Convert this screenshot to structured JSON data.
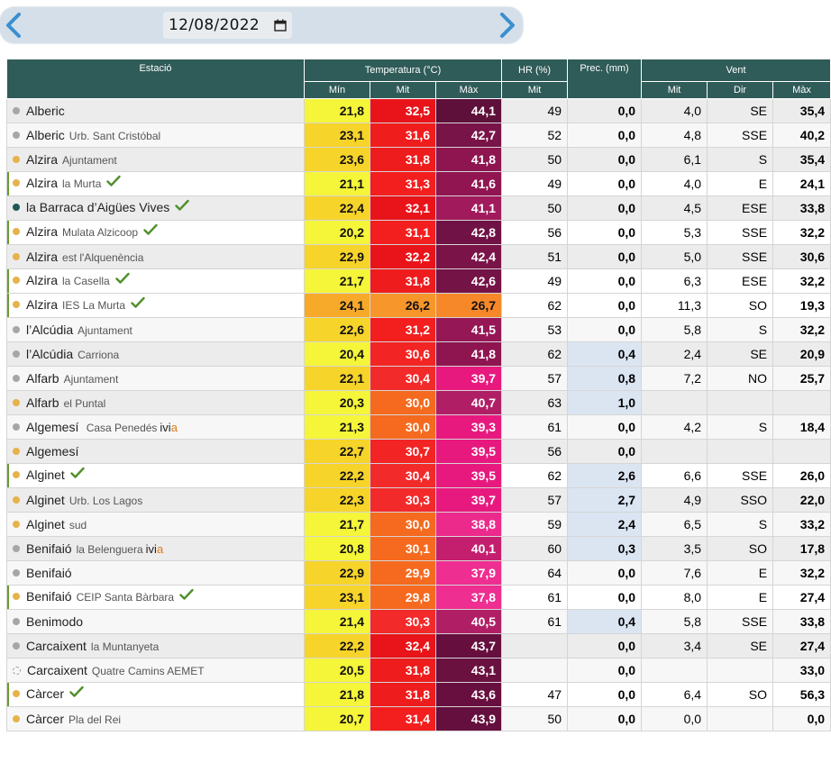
{
  "date": "12/08/2022",
  "colors": {
    "header_bg": "#2f5b58",
    "dot_gray": "#a6a6a6",
    "dot_orange": "#e6b24a",
    "dot_teal": "#1d5a56",
    "check": "#4f8f2a"
  },
  "icons": {
    "prev": "chevron-left-icon",
    "next": "chevron-right-icon",
    "calendar": "calendar-icon",
    "verified": "check-icon"
  },
  "headers": {
    "station": "Estació",
    "temperature": "Temperatura (°C)",
    "humidity": "HR (%)",
    "precipitation": "Prec. (mm)",
    "wind": "Vent",
    "min": "Mín",
    "mid": "Mit",
    "max": "Màx",
    "hr_mid": "Mit",
    "wind_mid": "Mit",
    "wind_dir": "Dir",
    "wind_max": "Màx"
  },
  "rows": [
    {
      "name": "Alberic",
      "sub": "",
      "dot": "gray",
      "check": false,
      "ivia": false,
      "mark": false,
      "tmin": "21,8",
      "tmid": "32,5",
      "tmax": "44,1",
      "hr": "49",
      "prec": "0,0",
      "wmid": "4,0",
      "wdir": "SE",
      "wmax": "35,4",
      "c": [
        "#f5f53a",
        "#e8141a",
        "#5e0f3a"
      ],
      "pb": false
    },
    {
      "name": "Alberic",
      "sub": "Urb. Sant Cristóbal",
      "dot": "gray",
      "check": false,
      "ivia": false,
      "mark": false,
      "tmin": "23,1",
      "tmid": "31,6",
      "tmax": "42,7",
      "hr": "52",
      "prec": "0,0",
      "wmid": "4,8",
      "wdir": "SSE",
      "wmax": "40,2",
      "c": [
        "#f7d42a",
        "#f01d1d",
        "#781448"
      ],
      "pb": false
    },
    {
      "name": "Alzira",
      "sub": "Ajuntament",
      "dot": "orange",
      "check": false,
      "ivia": false,
      "mark": false,
      "tmin": "23,6",
      "tmid": "31,8",
      "tmax": "41,8",
      "hr": "50",
      "prec": "0,0",
      "wmid": "6,1",
      "wdir": "S",
      "wmax": "35,4",
      "c": [
        "#f7d42a",
        "#ee1c1c",
        "#8e1550"
      ],
      "pb": false
    },
    {
      "name": "Alzira",
      "sub": "la Murta",
      "dot": "orange",
      "check": true,
      "ivia": false,
      "mark": true,
      "tmin": "21,1",
      "tmid": "31,3",
      "tmax": "41,6",
      "hr": "49",
      "prec": "0,0",
      "wmid": "4,0",
      "wdir": "E",
      "wmax": "24,1",
      "c": [
        "#f5f53a",
        "#f31e1e",
        "#901551"
      ],
      "pb": false
    },
    {
      "name": "la Barraca d’Aigües Vives",
      "sub": "",
      "dot": "teal",
      "check": true,
      "ivia": false,
      "mark": false,
      "tmin": "22,4",
      "tmid": "32,1",
      "tmax": "41,1",
      "hr": "50",
      "prec": "0,0",
      "wmid": "4,5",
      "wdir": "ESE",
      "wmax": "33,8",
      "c": [
        "#f7d42a",
        "#e8141a",
        "#a01a5c"
      ],
      "pb": false
    },
    {
      "name": "Alzira",
      "sub": "Mulata Alzicoop",
      "dot": "orange",
      "check": true,
      "ivia": false,
      "mark": true,
      "tmin": "20,2",
      "tmid": "31,1",
      "tmax": "42,8",
      "hr": "56",
      "prec": "0,0",
      "wmid": "5,3",
      "wdir": "SSE",
      "wmax": "32,2",
      "c": [
        "#f5f53a",
        "#f31e1e",
        "#701245"
      ],
      "pb": false
    },
    {
      "name": "Alzira",
      "sub": "est l'Alquenència",
      "dot": "orange",
      "check": false,
      "ivia": false,
      "mark": false,
      "tmin": "22,9",
      "tmid": "32,2",
      "tmax": "42,4",
      "hr": "51",
      "prec": "0,0",
      "wmid": "5,0",
      "wdir": "SSE",
      "wmax": "30,6",
      "c": [
        "#f7d42a",
        "#e8141a",
        "#7a1448"
      ],
      "pb": false
    },
    {
      "name": "Alzira",
      "sub": "la Casella",
      "dot": "orange",
      "check": true,
      "ivia": false,
      "mark": true,
      "tmin": "21,7",
      "tmid": "31,8",
      "tmax": "42,6",
      "hr": "49",
      "prec": "0,0",
      "wmid": "6,3",
      "wdir": "ESE",
      "wmax": "32,2",
      "c": [
        "#f5f53a",
        "#ee1c1c",
        "#741346"
      ],
      "pb": false
    },
    {
      "name": "Alzira",
      "sub": "IES La Murta",
      "dot": "orange",
      "check": true,
      "ivia": false,
      "mark": true,
      "tmin": "24,1",
      "tmid": "26,2",
      "tmax": "26,7",
      "hr": "62",
      "prec": "0,0",
      "wmid": "11,3",
      "wdir": "SO",
      "wmax": "19,3",
      "c": [
        "#f7a92a",
        "#f7962a",
        "#f7882a"
      ],
      "pb": false
    },
    {
      "name": "l’Alcúdia",
      "sub": "Ajuntament",
      "dot": "gray",
      "check": false,
      "ivia": false,
      "mark": false,
      "tmin": "22,6",
      "tmid": "31,2",
      "tmax": "41,5",
      "hr": "53",
      "prec": "0,0",
      "wmid": "5,8",
      "wdir": "S",
      "wmax": "32,2",
      "c": [
        "#f7d42a",
        "#f31e1e",
        "#961756"
      ],
      "pb": false
    },
    {
      "name": "l’Alcúdia",
      "sub": "Carriona",
      "dot": "gray",
      "check": false,
      "ivia": false,
      "mark": false,
      "tmin": "20,4",
      "tmid": "30,6",
      "tmax": "41,8",
      "hr": "62",
      "prec": "0,4",
      "wmid": "2,4",
      "wdir": "SE",
      "wmax": "20,9",
      "c": [
        "#f5f53a",
        "#f32424",
        "#8e1550"
      ],
      "pb": true
    },
    {
      "name": "Alfarb",
      "sub": "Ajuntament",
      "dot": "gray",
      "check": false,
      "ivia": false,
      "mark": false,
      "tmin": "22,1",
      "tmid": "30,4",
      "tmax": "39,7",
      "hr": "57",
      "prec": "0,8",
      "wmid": "7,2",
      "wdir": "NO",
      "wmax": "25,7",
      "c": [
        "#f7d42a",
        "#f32a2a",
        "#e8197e"
      ],
      "pb": true
    },
    {
      "name": "Alfarb",
      "sub": "el Puntal",
      "dot": "orange",
      "check": false,
      "ivia": false,
      "mark": false,
      "tmin": "20,3",
      "tmid": "30,0",
      "tmax": "40,7",
      "hr": "63",
      "prec": "1,0",
      "wmid": "",
      "wdir": "",
      "wmax": "",
      "c": [
        "#f5f53a",
        "#f56a1e",
        "#b01f66"
      ],
      "pb": true
    },
    {
      "name": "Algemesí",
      "sub": " Casa Penedés",
      "dot": "gray",
      "check": false,
      "ivia": true,
      "mark": false,
      "tmin": "21,3",
      "tmid": "30,0",
      "tmax": "39,3",
      "hr": "61",
      "prec": "0,0",
      "wmid": "4,2",
      "wdir": "S",
      "wmax": "18,4",
      "c": [
        "#f5f53a",
        "#f56a1e",
        "#e8197e"
      ],
      "pb": false
    },
    {
      "name": "Algemesí",
      "sub": "",
      "dot": "orange",
      "check": false,
      "ivia": false,
      "mark": false,
      "tmin": "22,7",
      "tmid": "30,7",
      "tmax": "39,5",
      "hr": "56",
      "prec": "0,0",
      "wmid": "",
      "wdir": "",
      "wmax": "",
      "c": [
        "#f7d42a",
        "#f32424",
        "#e8197e"
      ],
      "pb": false
    },
    {
      "name": "Alginet",
      "sub": "",
      "dot": "orange",
      "check": true,
      "ivia": false,
      "mark": true,
      "tmin": "22,2",
      "tmid": "30,4",
      "tmax": "39,5",
      "hr": "62",
      "prec": "2,6",
      "wmid": "6,6",
      "wdir": "SSE",
      "wmax": "26,0",
      "c": [
        "#f7d42a",
        "#f32a2a",
        "#e8197e"
      ],
      "pb": true
    },
    {
      "name": "Alginet",
      "sub": "Urb. Los Lagos",
      "dot": "orange",
      "check": false,
      "ivia": false,
      "mark": false,
      "tmin": "22,3",
      "tmid": "30,3",
      "tmax": "39,7",
      "hr": "57",
      "prec": "2,7",
      "wmid": "4,9",
      "wdir": "SSO",
      "wmax": "22,0",
      "c": [
        "#f7d42a",
        "#f32a2a",
        "#e8197e"
      ],
      "pb": true
    },
    {
      "name": "Alginet",
      "sub": "sud",
      "dot": "orange",
      "check": false,
      "ivia": false,
      "mark": false,
      "tmin": "21,7",
      "tmid": "30,0",
      "tmax": "38,8",
      "hr": "59",
      "prec": "2,4",
      "wmid": "6,5",
      "wdir": "S",
      "wmax": "33,2",
      "c": [
        "#f5f53a",
        "#f56a1e",
        "#ec2a8c"
      ],
      "pb": true
    },
    {
      "name": "Benifaió",
      "sub": "la Belenguera",
      "dot": "gray",
      "check": false,
      "ivia": true,
      "mark": false,
      "tmin": "20,8",
      "tmid": "30,1",
      "tmax": "40,1",
      "hr": "60",
      "prec": "0,3",
      "wmid": "3,5",
      "wdir": "SO",
      "wmax": "17,8",
      "c": [
        "#f5f53a",
        "#f56a1e",
        "#c41f6e"
      ],
      "pb": true
    },
    {
      "name": "Benifaió",
      "sub": "",
      "dot": "gray",
      "check": false,
      "ivia": false,
      "mark": false,
      "tmin": "22,9",
      "tmid": "29,9",
      "tmax": "37,9",
      "hr": "64",
      "prec": "0,0",
      "wmid": "7,6",
      "wdir": "E",
      "wmax": "32,2",
      "c": [
        "#f7d42a",
        "#f56a1e",
        "#ee2e90"
      ],
      "pb": false
    },
    {
      "name": "Benifaió",
      "sub": "CEIP Santa Bàrbara",
      "dot": "orange",
      "check": true,
      "ivia": false,
      "mark": true,
      "tmin": "23,1",
      "tmid": "29,8",
      "tmax": "37,8",
      "hr": "61",
      "prec": "0,0",
      "wmid": "8,0",
      "wdir": "E",
      "wmax": "27,4",
      "c": [
        "#f7d42a",
        "#f56a1e",
        "#ee2e90"
      ],
      "pb": false
    },
    {
      "name": "Benimodo",
      "sub": "",
      "dot": "gray",
      "check": false,
      "ivia": false,
      "mark": false,
      "tmin": "21,4",
      "tmid": "30,3",
      "tmax": "40,5",
      "hr": "61",
      "prec": "0,4",
      "wmid": "5,8",
      "wdir": "SSE",
      "wmax": "33,8",
      "c": [
        "#f5f53a",
        "#f32a2a",
        "#b01f66"
      ],
      "pb": true
    },
    {
      "name": "Carcaixent",
      "sub": "la Muntanyeta",
      "dot": "gray",
      "check": false,
      "ivia": false,
      "mark": false,
      "tmin": "22,2",
      "tmid": "32,4",
      "tmax": "43,7",
      "hr": "",
      "prec": "0,0",
      "wmid": "3,4",
      "wdir": "SE",
      "wmax": "27,4",
      "c": [
        "#f7d42a",
        "#e8141a",
        "#660f3e"
      ],
      "pb": false
    },
    {
      "name": "Carcaixent",
      "sub": "Quatre Camins AEMET",
      "dot": "empty",
      "check": false,
      "ivia": false,
      "mark": false,
      "tmin": "20,5",
      "tmid": "31,8",
      "tmax": "43,1",
      "hr": "",
      "prec": "0,0",
      "wmid": "",
      "wdir": "",
      "wmax": "33,0",
      "c": [
        "#f5f53a",
        "#ee1c1c",
        "#6a1140"
      ],
      "pb": false
    },
    {
      "name": "Càrcer",
      "sub": "",
      "dot": "orange",
      "check": true,
      "ivia": false,
      "mark": true,
      "tmin": "21,8",
      "tmid": "31,8",
      "tmax": "43,6",
      "hr": "47",
      "prec": "0,0",
      "wmid": "6,4",
      "wdir": "SO",
      "wmax": "56,3",
      "c": [
        "#f5f53a",
        "#ee1c1c",
        "#680f3f"
      ],
      "pb": false
    },
    {
      "name": "Càrcer",
      "sub": "Pla del Rei",
      "dot": "orange",
      "check": false,
      "ivia": false,
      "mark": false,
      "tmin": "20,7",
      "tmid": "31,4",
      "tmax": "43,9",
      "hr": "50",
      "prec": "0,0",
      "wmid": "0,0",
      "wdir": "",
      "wmax": "0,0",
      "c": [
        "#f5f53a",
        "#f31e1e",
        "#640f3d"
      ],
      "pb": false
    }
  ]
}
